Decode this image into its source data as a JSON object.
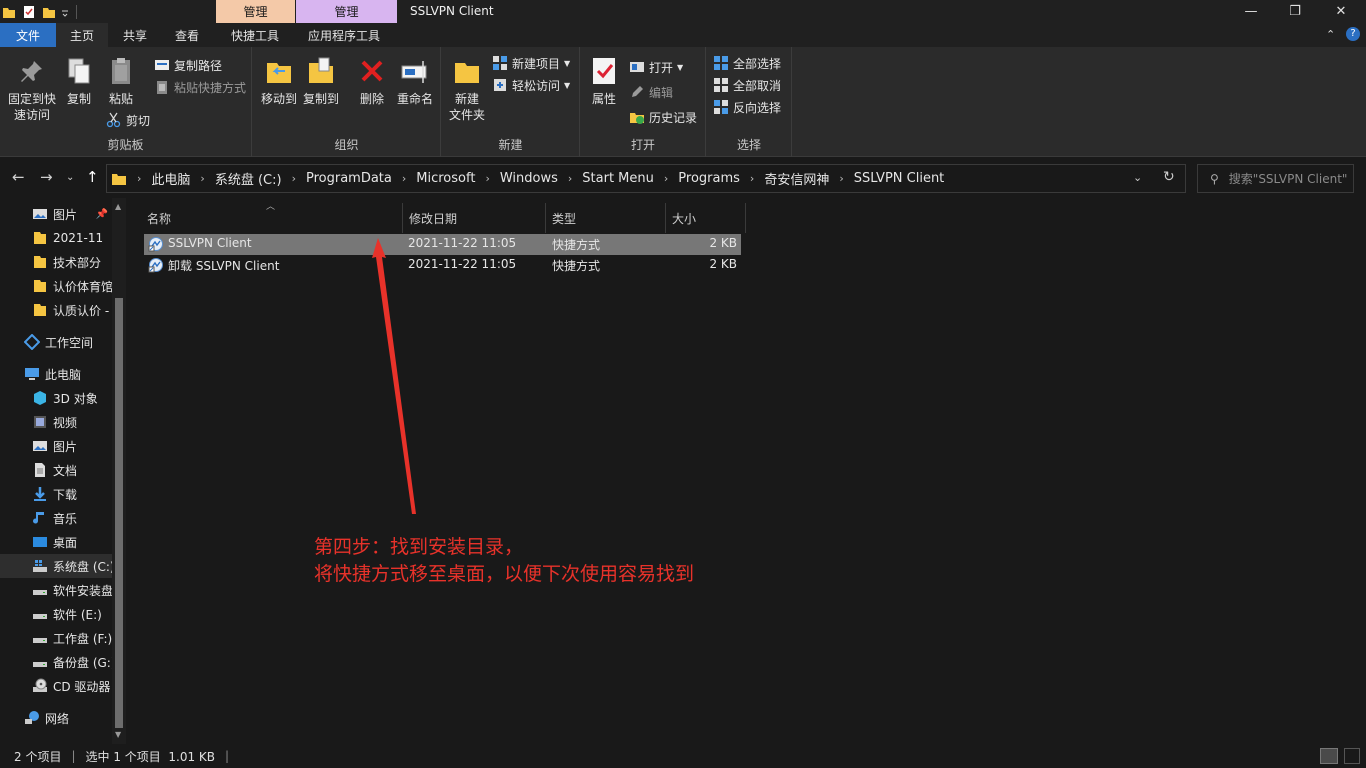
{
  "window": {
    "title": "SSLVPN Client",
    "context_tab_1": "管理",
    "context_tab_2": "管理",
    "minimize": "—",
    "maximize": "❐",
    "close": "✕"
  },
  "ribbon_tabs": {
    "file": "文件",
    "home": "主页",
    "share": "共享",
    "view": "查看",
    "shortcut_tools": "快捷工具",
    "app_tools": "应用程序工具"
  },
  "ribbon": {
    "clipboard": {
      "label": "剪贴板",
      "pin_line1": "固定到快",
      "pin_line2": "速访问",
      "copy": "复制",
      "paste": "粘贴",
      "copy_path": "复制路径",
      "paste_shortcut": "粘贴快捷方式",
      "cut": "剪切"
    },
    "organize": {
      "label": "组织",
      "move_to": "移动到",
      "copy_to": "复制到",
      "delete": "删除",
      "rename": "重命名"
    },
    "new": {
      "label": "新建",
      "new_folder_line1": "新建",
      "new_folder_line2": "文件夹",
      "new_item": "新建项目",
      "easy_access": "轻松访问"
    },
    "open": {
      "label": "打开",
      "properties": "属性",
      "open": "打开",
      "edit": "编辑",
      "history": "历史记录"
    },
    "select": {
      "label": "选择",
      "select_all": "全部选择",
      "select_none": "全部取消",
      "invert": "反向选择"
    }
  },
  "address": {
    "crumbs": [
      "此电脑",
      "系统盘 (C:)",
      "ProgramData",
      "Microsoft",
      "Windows",
      "Start Menu",
      "Programs",
      "奇安信网神",
      "SSLVPN Client"
    ],
    "search_placeholder": "搜索\"SSLVPN Client\""
  },
  "nav": {
    "quick": [
      "图片",
      "2021-11",
      "技术部分",
      "认价体育馆",
      "认质认价 -"
    ],
    "workspace": "工作空间",
    "this_pc": "此电脑",
    "pc_items": [
      "3D 对象",
      "视频",
      "图片",
      "文档",
      "下载",
      "音乐",
      "桌面",
      "系统盘 (C:)",
      "软件安装盘",
      "软件 (E:)",
      "工作盘 (F:)",
      "备份盘 (G:)",
      "CD 驱动器"
    ],
    "network": "网络"
  },
  "columns": {
    "name": "名称",
    "modified": "修改日期",
    "type": "类型",
    "size": "大小"
  },
  "files": [
    {
      "name": "SSLVPN Client",
      "modified": "2021-11-22 11:05",
      "type": "快捷方式",
      "size": "2 KB"
    },
    {
      "name": "卸载 SSLVPN Client",
      "modified": "2021-11-22 11:05",
      "type": "快捷方式",
      "size": "2 KB"
    }
  ],
  "annotation": {
    "line1": "第四步：找到安装目录，",
    "line2": "将快捷方式移至桌面，以便下次使用容易找到"
  },
  "status": {
    "count": "2 个项目",
    "selected": "选中 1 个项目  1.01 KB"
  },
  "colors": {
    "accent": "#2b6fc2",
    "annotation": "#e8322a",
    "context_tab_1": "#f4c9a8",
    "context_tab_2": "#d8b5f0"
  }
}
